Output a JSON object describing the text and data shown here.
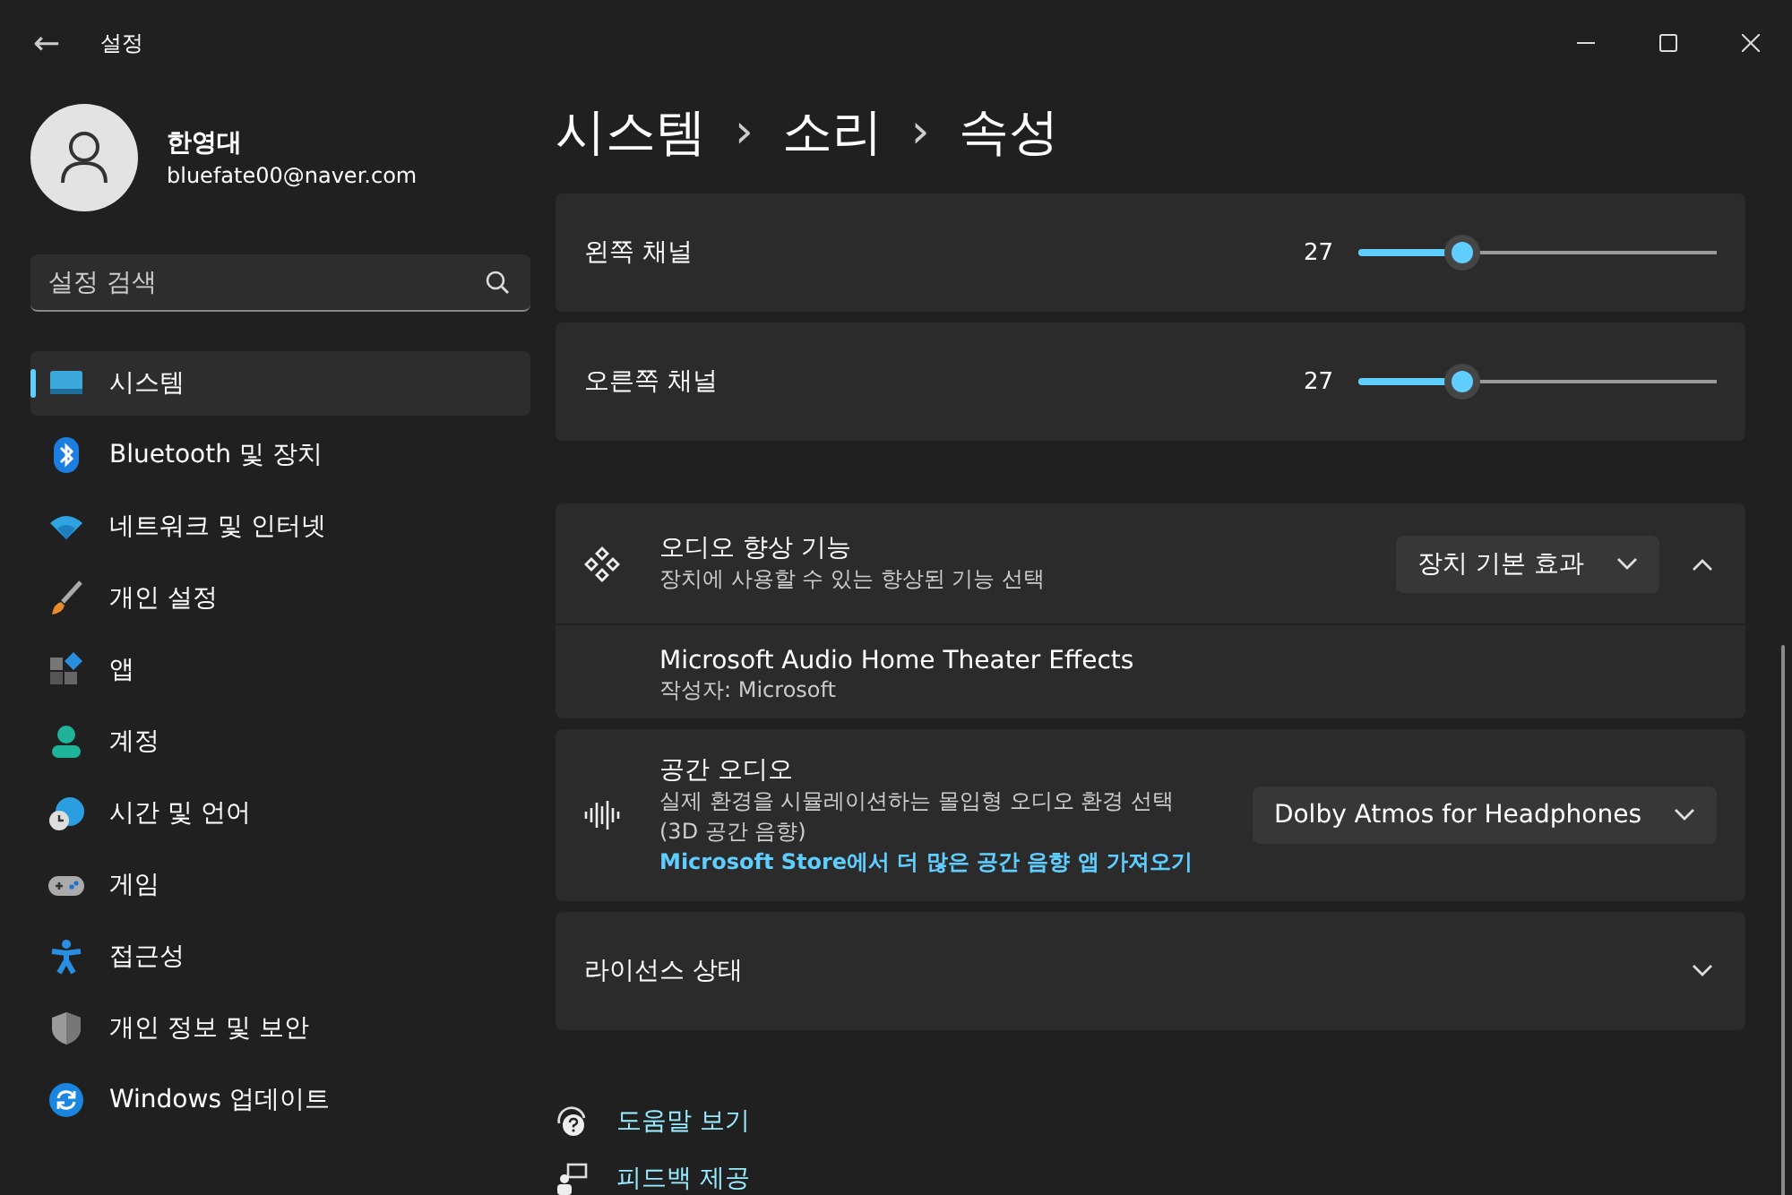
{
  "window": {
    "title": "설정",
    "back": "←"
  },
  "profile": {
    "name": "한영대",
    "email": "bluefate00@naver.com"
  },
  "search": {
    "placeholder": "설정 검색"
  },
  "nav": [
    {
      "label": "시스템",
      "kind": "system",
      "selected": true
    },
    {
      "label": "Bluetooth 및 장치",
      "kind": "bluetooth",
      "selected": false
    },
    {
      "label": "네트워크 및 인터넷",
      "kind": "network",
      "selected": false
    },
    {
      "label": "개인 설정",
      "kind": "brush",
      "selected": false
    },
    {
      "label": "앱",
      "kind": "apps",
      "selected": false
    },
    {
      "label": "계정",
      "kind": "account",
      "selected": false
    },
    {
      "label": "시간 및 언어",
      "kind": "time",
      "selected": false
    },
    {
      "label": "게임",
      "kind": "game",
      "selected": false
    },
    {
      "label": "접근성",
      "kind": "accessibility",
      "selected": false
    },
    {
      "label": "개인 정보 및 보안",
      "kind": "shield",
      "selected": false
    },
    {
      "label": "Windows 업데이트",
      "kind": "update",
      "selected": false
    }
  ],
  "breadcrumb": [
    "시스템",
    "›",
    "소리",
    "›",
    "속성"
  ],
  "channels": [
    {
      "label": "왼쪽 채널",
      "reading": "27",
      "level": 0.29
    },
    {
      "label": "오른쪽 채널",
      "reading": "27",
      "level": 0.29
    }
  ],
  "enhancement": {
    "title": "오디오 향상 기능",
    "description": "장치에 사용할 수 있는 향상된 기능 선택",
    "dropdown": "장치 기본 효과",
    "expanded": true,
    "effect": {
      "name": "Microsoft Audio Home Theater Effects",
      "publisher": "작성자: Microsoft"
    }
  },
  "spatial": {
    "title": "공간 오디오",
    "description": "실제 환경을 시뮬레이션하는 몰입형 오디오 환경 선택",
    "note": "(3D 공간 음향)",
    "link": "Microsoft Store에서 더 많은 공간 음향 앱 가져오기",
    "dropdown": "Dolby Atmos for Headphones"
  },
  "license": {
    "title": "라이선스 상태",
    "expanded": false
  },
  "footer_links": [
    {
      "label": "도움말 보기",
      "kind": "help"
    },
    {
      "label": "피드백 제공",
      "kind": "feedback"
    }
  ]
}
